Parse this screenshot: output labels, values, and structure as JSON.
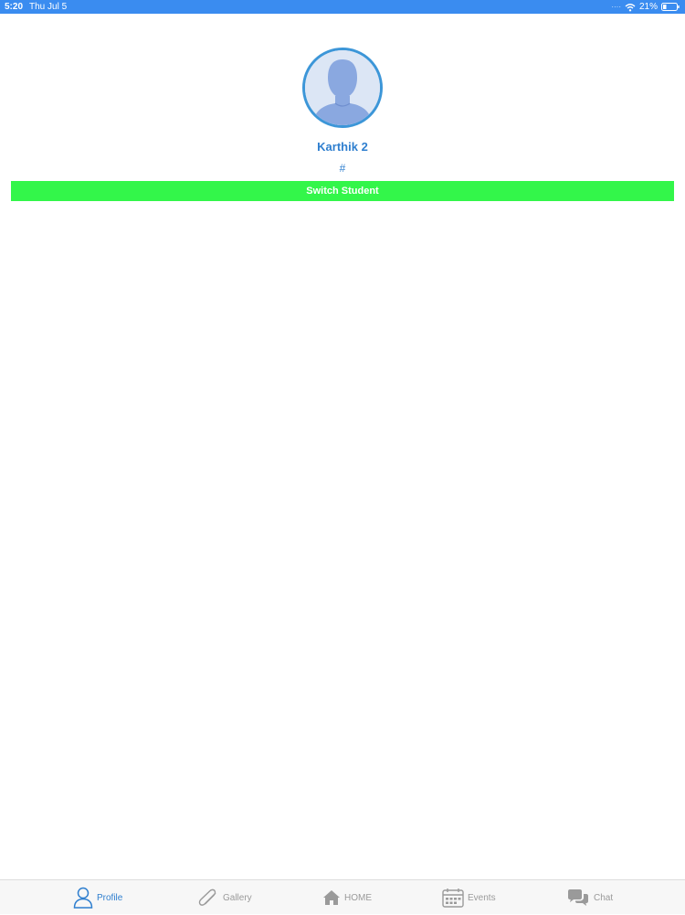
{
  "status_bar": {
    "time": "5:20",
    "date": "Thu Jul 5",
    "battery": "21%",
    "background_color": "#3a8cf0",
    "icons": [
      "wifi-icon",
      "battery-icon"
    ]
  },
  "profile": {
    "avatar_icon": "person-silhouette-icon",
    "name": "Karthik 2",
    "id": "#",
    "accent_color": "#2f7fcf"
  },
  "switch_button": {
    "label": "Switch Student",
    "background_color": "#33f64a"
  },
  "tab_bar": {
    "active": "Profile",
    "tabs": [
      {
        "label": "Profile",
        "icon": "person-icon"
      },
      {
        "label": "Gallery",
        "icon": "paperclip-icon"
      },
      {
        "label": "HOME",
        "icon": "house-icon"
      },
      {
        "label": "Events",
        "icon": "calendar-icon"
      },
      {
        "label": "Chat",
        "icon": "chat-bubbles-icon"
      }
    ]
  }
}
